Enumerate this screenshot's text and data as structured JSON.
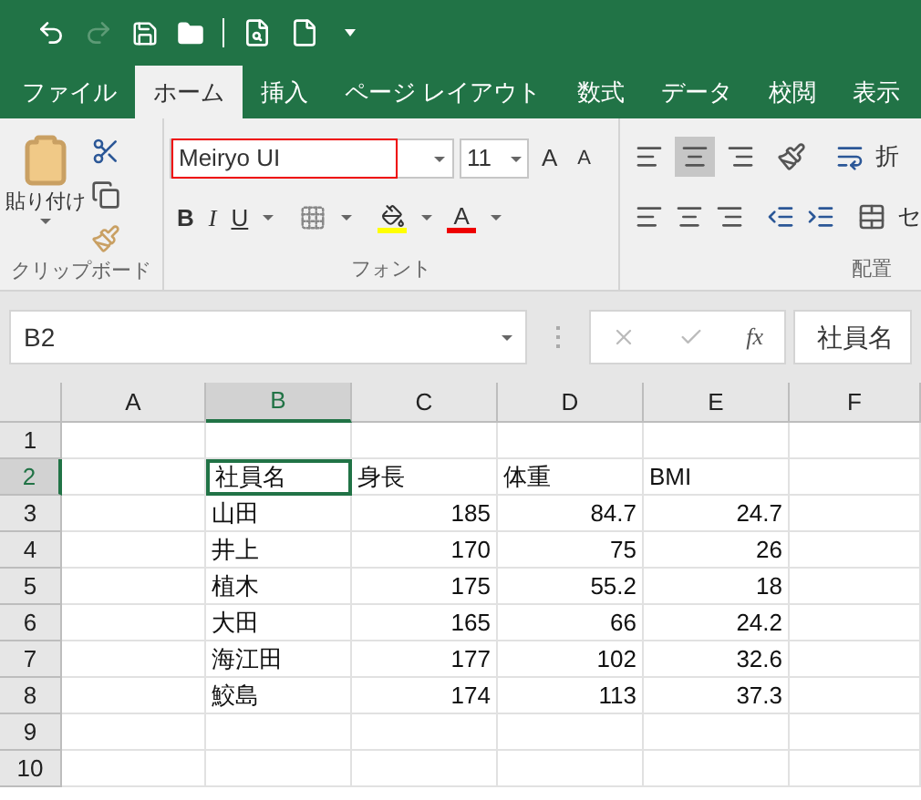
{
  "tabs": [
    {
      "label": "ファイル",
      "selected": false
    },
    {
      "label": "ホーム",
      "selected": true
    },
    {
      "label": "挿入",
      "selected": false
    },
    {
      "label": "ページ レイアウト",
      "selected": false
    },
    {
      "label": "数式",
      "selected": false
    },
    {
      "label": "データ",
      "selected": false
    },
    {
      "label": "校閲",
      "selected": false
    },
    {
      "label": "表示",
      "selected": false
    }
  ],
  "ribbon": {
    "clipboard": {
      "paste_label": "貼り付け",
      "group_label": "クリップボード"
    },
    "font": {
      "font_name": "Meiryo UI",
      "font_size": "11",
      "grow": "A",
      "shrink": "A",
      "bold": "B",
      "italic": "I",
      "underline": "U",
      "font_color": "A",
      "group_label": "フォント"
    },
    "alignment": {
      "wrap": "折",
      "merge": "セ",
      "group_label": "配置"
    }
  },
  "formula_bar": {
    "name_box": "B2",
    "fx": "fx",
    "value": "社員名"
  },
  "sheet": {
    "columns": [
      {
        "label": "A",
        "selected": false
      },
      {
        "label": "B",
        "selected": true
      },
      {
        "label": "C",
        "selected": false
      },
      {
        "label": "D",
        "selected": false
      },
      {
        "label": "E",
        "selected": false
      },
      {
        "label": "F",
        "selected": false
      }
    ],
    "rows": [
      {
        "header": "1",
        "selected": false,
        "cells": []
      },
      {
        "header": "2",
        "selected": true,
        "cells": [
          {
            "text": "社員名",
            "kind": "text",
            "selected": true
          },
          {
            "text": "身長",
            "kind": "text",
            "selected": false
          },
          {
            "text": "体重",
            "kind": "text",
            "selected": false
          },
          {
            "text": "BMI",
            "kind": "text",
            "selected": false
          }
        ]
      },
      {
        "header": "3",
        "selected": false,
        "cells": [
          {
            "text": "山田",
            "kind": "text",
            "selected": false
          },
          {
            "text": "185",
            "kind": "number",
            "selected": false
          },
          {
            "text": "84.7",
            "kind": "number",
            "selected": false
          },
          {
            "text": "24.7",
            "kind": "number",
            "selected": false
          }
        ]
      },
      {
        "header": "4",
        "selected": false,
        "cells": [
          {
            "text": "井上",
            "kind": "text",
            "selected": false
          },
          {
            "text": "170",
            "kind": "number",
            "selected": false
          },
          {
            "text": "75",
            "kind": "number",
            "selected": false
          },
          {
            "text": "26",
            "kind": "number",
            "selected": false
          }
        ]
      },
      {
        "header": "5",
        "selected": false,
        "cells": [
          {
            "text": "植木",
            "kind": "text",
            "selected": false
          },
          {
            "text": "175",
            "kind": "number",
            "selected": false
          },
          {
            "text": "55.2",
            "kind": "number",
            "selected": false
          },
          {
            "text": "18",
            "kind": "number",
            "selected": false
          }
        ]
      },
      {
        "header": "6",
        "selected": false,
        "cells": [
          {
            "text": "大田",
            "kind": "text",
            "selected": false
          },
          {
            "text": "165",
            "kind": "number",
            "selected": false
          },
          {
            "text": "66",
            "kind": "number",
            "selected": false
          },
          {
            "text": "24.2",
            "kind": "number",
            "selected": false
          }
        ]
      },
      {
        "header": "7",
        "selected": false,
        "cells": [
          {
            "text": "海江田",
            "kind": "text",
            "selected": false
          },
          {
            "text": "177",
            "kind": "number",
            "selected": false
          },
          {
            "text": "102",
            "kind": "number",
            "selected": false
          },
          {
            "text": "32.6",
            "kind": "number",
            "selected": false
          }
        ]
      },
      {
        "header": "8",
        "selected": false,
        "cells": [
          {
            "text": "鮫島",
            "kind": "text",
            "selected": false
          },
          {
            "text": "174",
            "kind": "number",
            "selected": false
          },
          {
            "text": "113",
            "kind": "number",
            "selected": false
          },
          {
            "text": "37.3",
            "kind": "number",
            "selected": false
          }
        ]
      },
      {
        "header": "9",
        "selected": false,
        "cells": []
      },
      {
        "header": "10",
        "selected": false,
        "cells": []
      }
    ]
  }
}
